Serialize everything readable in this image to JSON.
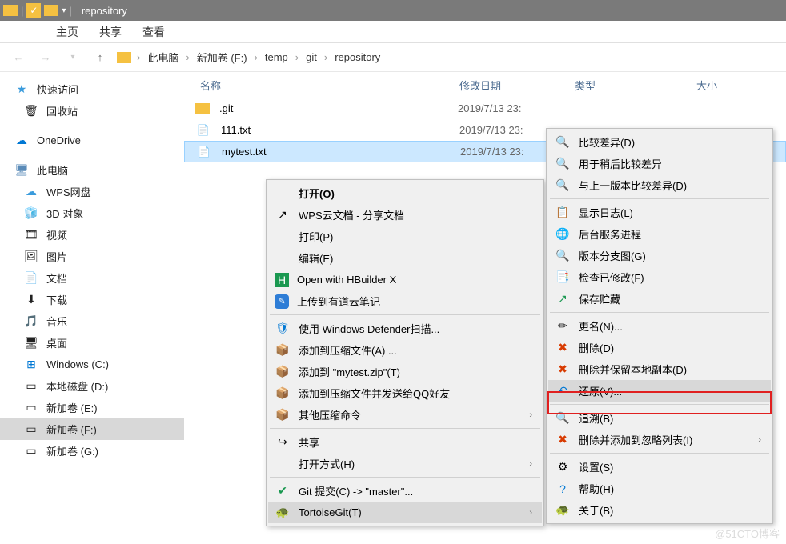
{
  "titlebar": {
    "title": "repository"
  },
  "ribbon": {
    "home": "主页",
    "share": "共享",
    "view": "查看"
  },
  "breadcrumb": {
    "items": [
      "此电脑",
      "新加卷 (F:)",
      "temp",
      "git",
      "repository"
    ]
  },
  "columns": {
    "name": "名称",
    "date": "修改日期",
    "type": "类型",
    "size": "大小"
  },
  "sidebar": {
    "quick_access": "快速访问",
    "recycle": "回收站",
    "onedrive": "OneDrive",
    "this_pc": "此电脑",
    "wps": "WPS网盘",
    "d3": "3D 对象",
    "videos": "视频",
    "pictures": "图片",
    "documents": "文档",
    "downloads": "下载",
    "music": "音乐",
    "desktop": "桌面",
    "winc": "Windows (C:)",
    "locald": "本地磁盘 (D:)",
    "vole": "新加卷 (E:)",
    "volf": "新加卷 (F:)",
    "volg": "新加卷 (G:)"
  },
  "files": [
    {
      "name": ".git",
      "date": "2019/7/13 23:"
    },
    {
      "name": "111.txt",
      "date": "2019/7/13 23:"
    },
    {
      "name": "mytest.txt",
      "date": "2019/7/13 23:"
    }
  ],
  "menu1": {
    "open": "打开(O)",
    "wps_cloud": "WPS云文档 - 分享文档",
    "print": "打印(P)",
    "edit": "编辑(E)",
    "hbuilder": "Open with HBuilder X",
    "youdao": "上传到有道云笔记",
    "defender": "使用 Windows Defender扫描...",
    "add_zip_a": "添加到压缩文件(A) ...",
    "add_zip_t": "添加到 \"mytest.zip\"(T)",
    "add_zip_qq": "添加到压缩文件并发送给QQ好友",
    "other_zip": "其他压缩命令",
    "share": "共享",
    "open_with": "打开方式(H)",
    "git_commit": "Git 提交(C) -> \"master\"...",
    "tortoise": "TortoiseGit(T)"
  },
  "menu2": {
    "diff": "比较差异(D)",
    "diff_later": "用于稍后比较差异",
    "diff_prev": "与上一版本比较差异(D)",
    "log": "显示日志(L)",
    "daemon": "后台服务进程",
    "rev_graph": "版本分支图(G)",
    "check_mod": "检查已修改(F)",
    "stash": "保存贮藏",
    "rename": "更名(N)...",
    "delete": "删除(D)",
    "delete_keep": "删除并保留本地副本(D)",
    "revert": "还原(V)...",
    "blame": "追溯(B)",
    "add_ignore": "删除并添加到忽略列表(I)",
    "settings": "设置(S)",
    "help": "帮助(H)",
    "about": "关于(B)"
  },
  "watermark": "@51CTO博客"
}
